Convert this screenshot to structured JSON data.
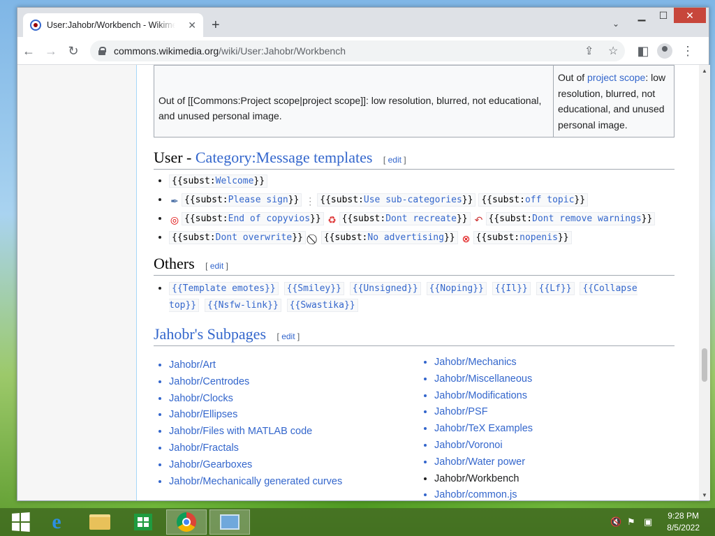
{
  "browser": {
    "tab_title": "User:Jahobr/Workbench - Wikimedia Commons",
    "tab_close": "✕",
    "new_tab": "+",
    "url_domain": "commons.wikimedia.org",
    "url_path": "/wiki/User:Jahobr/Workbench"
  },
  "table": {
    "left_cell": "Out of [[Commons:Project scope|project scope]]: low resolution, blurred, not educational, and unused personal image.",
    "right_prefix": "Out of ",
    "right_link": "project scope",
    "right_suffix": ": low resolution, blurred, not educational, and unused personal image."
  },
  "section_user": {
    "prefix": "User - ",
    "link": "Category:Message templates",
    "edit": "edit",
    "rows": [
      [
        {
          "icon": "",
          "pre": "{{subst:",
          "name": "Welcome",
          "post": "}}"
        }
      ],
      [
        {
          "icon": "pen-icon",
          "pre": "{{subst:",
          "name": "Please sign",
          "post": "}}"
        },
        {
          "icon": "tree-icon",
          "pre": "{{subst:",
          "name": "Use sub-categories",
          "post": "}}"
        },
        {
          "icon": "",
          "pre": "{{subst:",
          "name": "off topic",
          "post": "}}"
        }
      ],
      [
        {
          "icon": "target-icon",
          "pre": "{{subst:",
          "name": "End of copyvios",
          "post": "}}"
        },
        {
          "icon": "recycle-icon",
          "pre": "{{subst:",
          "name": "Dont recreate",
          "post": "}}"
        },
        {
          "icon": "undo-icon",
          "pre": "{{subst:",
          "name": "Dont remove warnings",
          "post": "}}"
        }
      ],
      [
        {
          "icon": "",
          "pre": "{{subst:",
          "name": "Dont overwrite",
          "post": "}}"
        },
        {
          "icon": "no-dollar-icon",
          "pre": "{{subst:",
          "name": "No advertising",
          "post": "}}"
        },
        {
          "icon": "no-entry-icon",
          "pre": "{{subst:",
          "name": "nopenis",
          "post": "}}"
        }
      ]
    ]
  },
  "section_others": {
    "title": "Others",
    "edit": "edit",
    "items": [
      "{{Template emotes}}",
      "{{Smiley}}",
      "{{Unsigned}}",
      "{{Noping}}",
      "{{Il}}",
      "{{Lf}}",
      "{{Collapse top}}",
      "{{Nsfw-link}}",
      "{{Swastika}}"
    ]
  },
  "section_subpages": {
    "title": "Jahobr's Subpages",
    "edit": "edit",
    "left": [
      "Jahobr/Art",
      "Jahobr/Centrodes",
      "Jahobr/Clocks",
      "Jahobr/Ellipses",
      "Jahobr/Files with MATLAB code",
      "Jahobr/Fractals",
      "Jahobr/Gearboxes",
      "Jahobr/Mechanically generated curves"
    ],
    "right": [
      "Jahobr/Mechanics",
      "Jahobr/Miscellaneous",
      "Jahobr/Modifications",
      "Jahobr/PSF",
      "Jahobr/TeX Examples",
      "Jahobr/Voronoi",
      "Jahobr/Water power",
      "Jahobr/Workbench",
      "Jahobr/common.js"
    ],
    "current": "Jahobr/Workbench"
  },
  "taskbar": {
    "time": "9:28 PM",
    "date": "8/5/2022"
  }
}
